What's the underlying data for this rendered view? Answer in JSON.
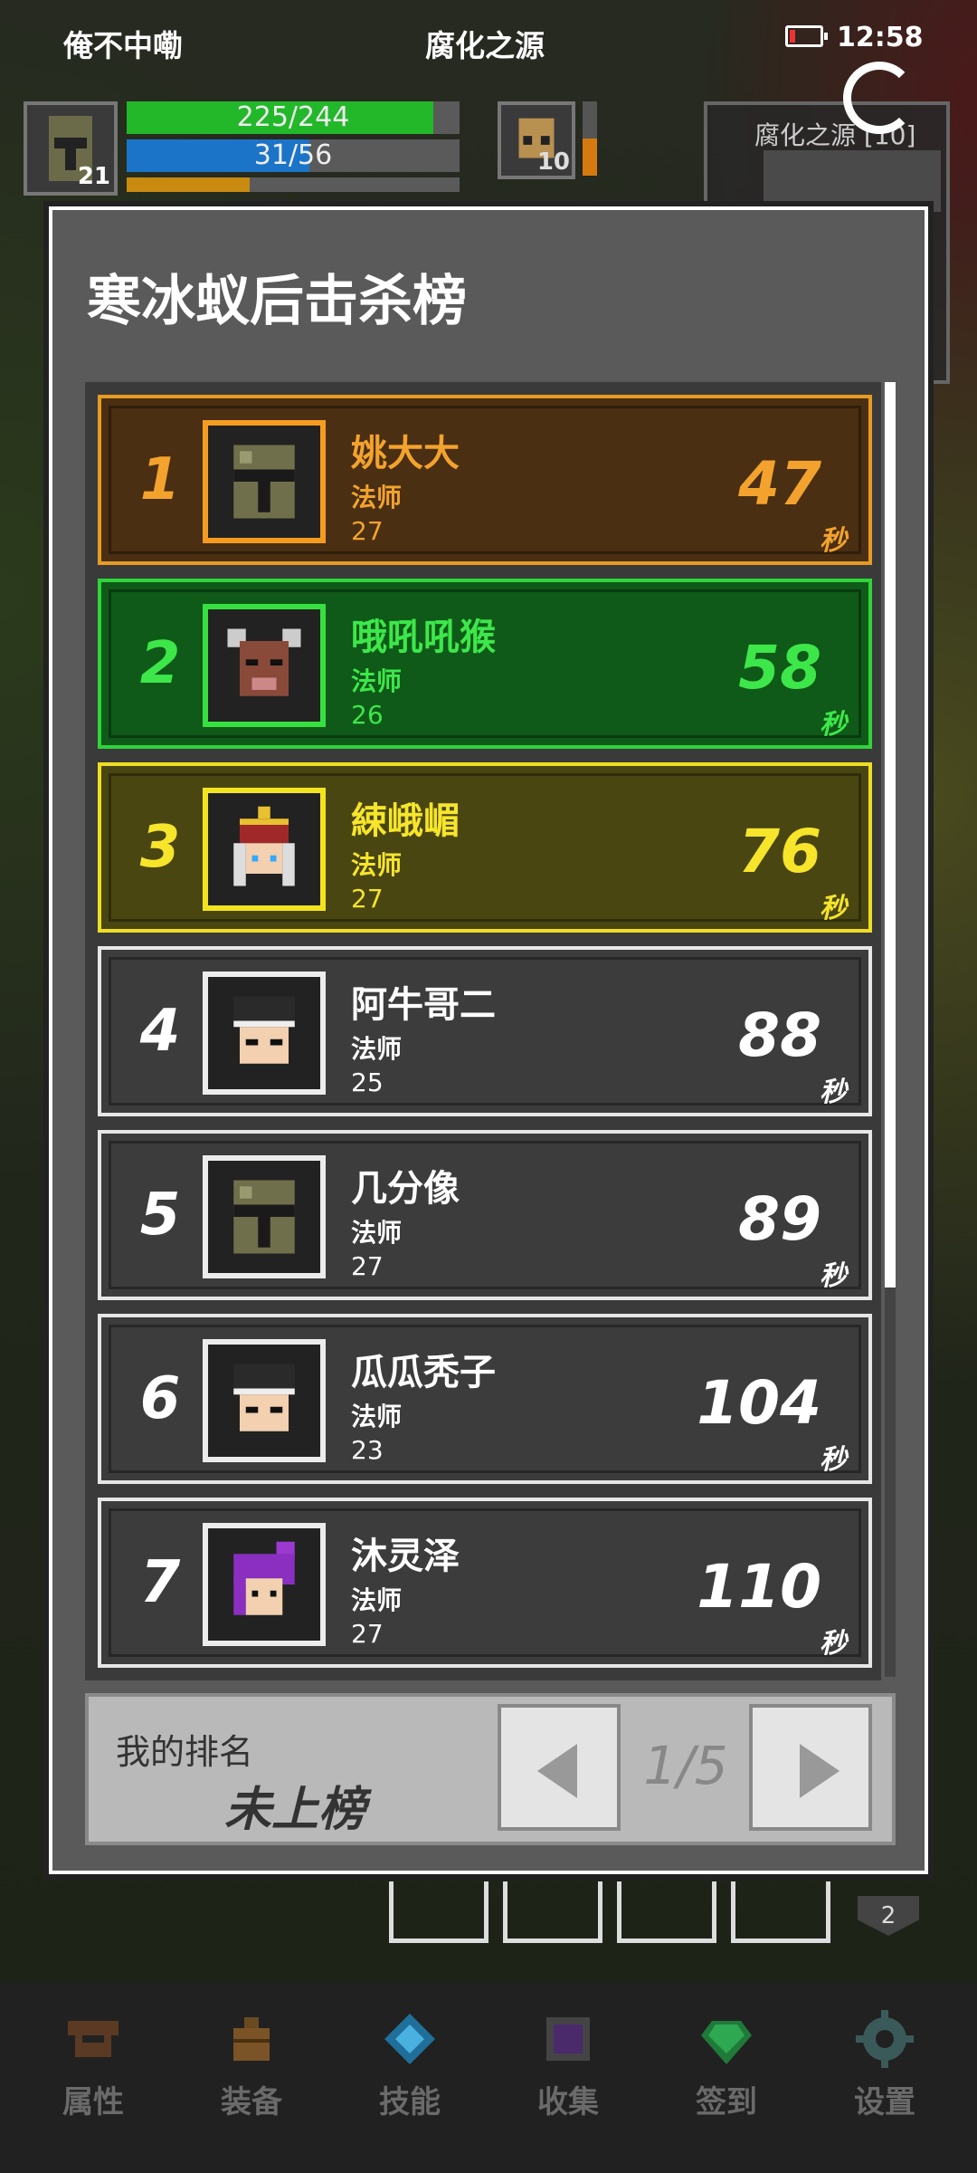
{
  "status_bar": {
    "player_name": "俺不中嘞",
    "zone_name": "腐化之源",
    "time": "12:58"
  },
  "hud": {
    "player_level": "21",
    "hp": "225/244",
    "mp": "31/56",
    "pet_level": "10",
    "minimap_title": "腐化之源 [10]"
  },
  "leaderboard": {
    "title": "寒冰蚁后击杀榜",
    "entries": [
      {
        "rank": "1",
        "name": "姚大大",
        "class": "法师",
        "level": "27",
        "time": "47",
        "unit": "秒",
        "tier": "gold",
        "avatar": "helmet-knight"
      },
      {
        "rank": "2",
        "name": "哦吼吼猴",
        "class": "法师",
        "level": "26",
        "time": "58",
        "unit": "秒",
        "tier": "green",
        "avatar": "minotaur"
      },
      {
        "rank": "3",
        "name": "綀峨嵋",
        "class": "法师",
        "level": "27",
        "time": "76",
        "unit": "秒",
        "tier": "yellow",
        "avatar": "crowned-mage"
      },
      {
        "rank": "4",
        "name": "阿牛哥二",
        "class": "法师",
        "level": "25",
        "time": "88",
        "unit": "秒",
        "tier": "gray",
        "avatar": "headband-warrior"
      },
      {
        "rank": "5",
        "name": "几分像",
        "class": "法师",
        "level": "27",
        "time": "89",
        "unit": "秒",
        "tier": "gray",
        "avatar": "helmet-knight"
      },
      {
        "rank": "6",
        "name": "瓜瓜秃子",
        "class": "法师",
        "level": "23",
        "time": "104",
        "unit": "秒",
        "tier": "gray",
        "avatar": "headband-warrior"
      },
      {
        "rank": "7",
        "name": "沐灵泽",
        "class": "法师",
        "level": "27",
        "time": "110",
        "unit": "秒",
        "tier": "gray",
        "avatar": "purple-hair-girl"
      }
    ],
    "my_rank_label": "我的排名",
    "my_rank_value": "未上榜",
    "page": "1/5"
  },
  "bottom_nav": [
    {
      "label": "属性",
      "icon": "helmet-icon"
    },
    {
      "label": "装备",
      "icon": "bag-icon"
    },
    {
      "label": "技能",
      "icon": "skill-gem-icon"
    },
    {
      "label": "收集",
      "icon": "collection-box-icon"
    },
    {
      "label": "签到",
      "icon": "emerald-icon"
    },
    {
      "label": "设置",
      "icon": "gear-icon"
    }
  ],
  "slot_badge": "2",
  "colors": {
    "gold": "#f3a32d",
    "green": "#3de74a",
    "yellow": "#f6e52a",
    "hp": "#22b82a",
    "mp": "#1c74c8",
    "xp": "#c98a10"
  }
}
